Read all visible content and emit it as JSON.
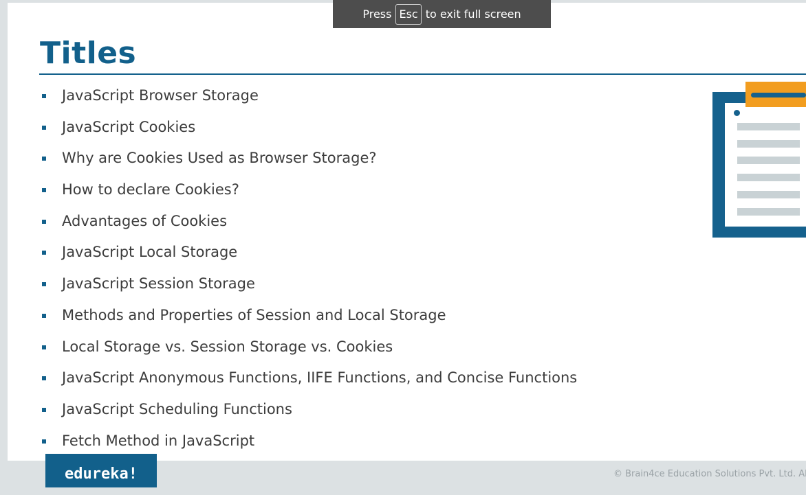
{
  "fullscreen_notice": {
    "before_key": "Press",
    "key": "Esc",
    "after_key": "to exit full screen"
  },
  "slide": {
    "title": "Titles",
    "topics": [
      "JavaScript Browser Storage",
      "JavaScript Cookies",
      "Why are Cookies Used as Browser Storage?",
      "How to declare Cookies?",
      "Advantages of Cookies",
      "JavaScript Local Storage",
      "JavaScript Session Storage",
      "Methods and Properties of Session and Local Storage",
      "Local Storage vs. Session Storage vs. Cookies",
      "JavaScript Anonymous Functions, IIFE Functions, and Concise Functions",
      "JavaScript Scheduling Functions",
      "Fetch Method in JavaScript"
    ],
    "illustration_icon": "clipboard-list-icon"
  },
  "footer": {
    "brand": "edureka!",
    "copyright": "© Brain4ce Education Solutions Pvt. Ltd. Al"
  },
  "colors": {
    "accent_blue": "#12608b",
    "accent_orange": "#f29d1f",
    "background": "#dce1e3"
  }
}
